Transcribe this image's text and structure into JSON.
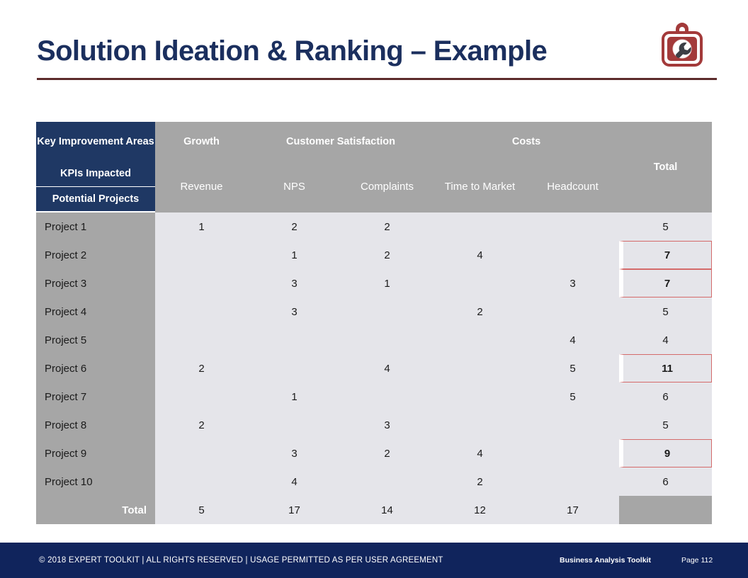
{
  "slide": {
    "title": "Solution Ideation & Ranking – Example",
    "accent_navy": "#1f3864",
    "accent_gray": "#a6a6a6",
    "accent_cell": "#e5e5ea",
    "accent_red": "#d46a6a",
    "rule_color": "#5c2b2b",
    "footer_bg": "#10245c"
  },
  "logo": {
    "name": "expert-toolkit-logo",
    "shape": "toolbox-with-wrench",
    "color": "#a33a3a"
  },
  "table": {
    "corner": {
      "key_improvement_areas": "Key Improvement Areas",
      "kpis_impacted": "KPIs Impacted",
      "potential_projects": "Potential Projects"
    },
    "groups": [
      {
        "label": "Growth",
        "span": 1
      },
      {
        "label": "Customer Satisfaction",
        "span": 2
      },
      {
        "label": "Costs",
        "span": 2
      }
    ],
    "kpis": [
      "Revenue",
      "NPS",
      "Complaints",
      "Time to Market",
      "Headcount"
    ],
    "total_header": "Total",
    "total_row_label": "Total",
    "rows": [
      {
        "label": "Project 1",
        "values": [
          "1",
          "2",
          "2",
          "",
          ""
        ],
        "total": "5",
        "highlight": false
      },
      {
        "label": "Project 2",
        "values": [
          "",
          "1",
          "2",
          "4",
          ""
        ],
        "total": "7",
        "highlight": true
      },
      {
        "label": "Project 3",
        "values": [
          "",
          "3",
          "1",
          "",
          "3"
        ],
        "total": "7",
        "highlight": true
      },
      {
        "label": "Project 4",
        "values": [
          "",
          "3",
          "",
          "2",
          ""
        ],
        "total": "5",
        "highlight": false
      },
      {
        "label": "Project 5",
        "values": [
          "",
          "",
          "",
          "",
          "4"
        ],
        "total": "4",
        "highlight": false
      },
      {
        "label": "Project 6",
        "values": [
          "2",
          "",
          "4",
          "",
          "5"
        ],
        "total": "11",
        "highlight": true
      },
      {
        "label": "Project 7",
        "values": [
          "",
          "1",
          "",
          "",
          "5"
        ],
        "total": "6",
        "highlight": false
      },
      {
        "label": "Project 8",
        "values": [
          "2",
          "",
          "3",
          "",
          ""
        ],
        "total": "5",
        "highlight": false
      },
      {
        "label": "Project 9",
        "values": [
          "",
          "3",
          "2",
          "4",
          ""
        ],
        "total": "9",
        "highlight": true
      },
      {
        "label": "Project 10",
        "values": [
          "",
          "4",
          "",
          "2",
          ""
        ],
        "total": "6",
        "highlight": false
      }
    ],
    "totals": [
      "5",
      "17",
      "14",
      "12",
      "17"
    ],
    "totals_grand": ""
  },
  "footer": {
    "copyright": "© 2018 EXPERT TOOLKIT | ALL RIGHTS RESERVED | USAGE PERMITTED AS PER USER AGREEMENT",
    "brand": "Business Analysis Toolkit",
    "page": "Page 112"
  }
}
